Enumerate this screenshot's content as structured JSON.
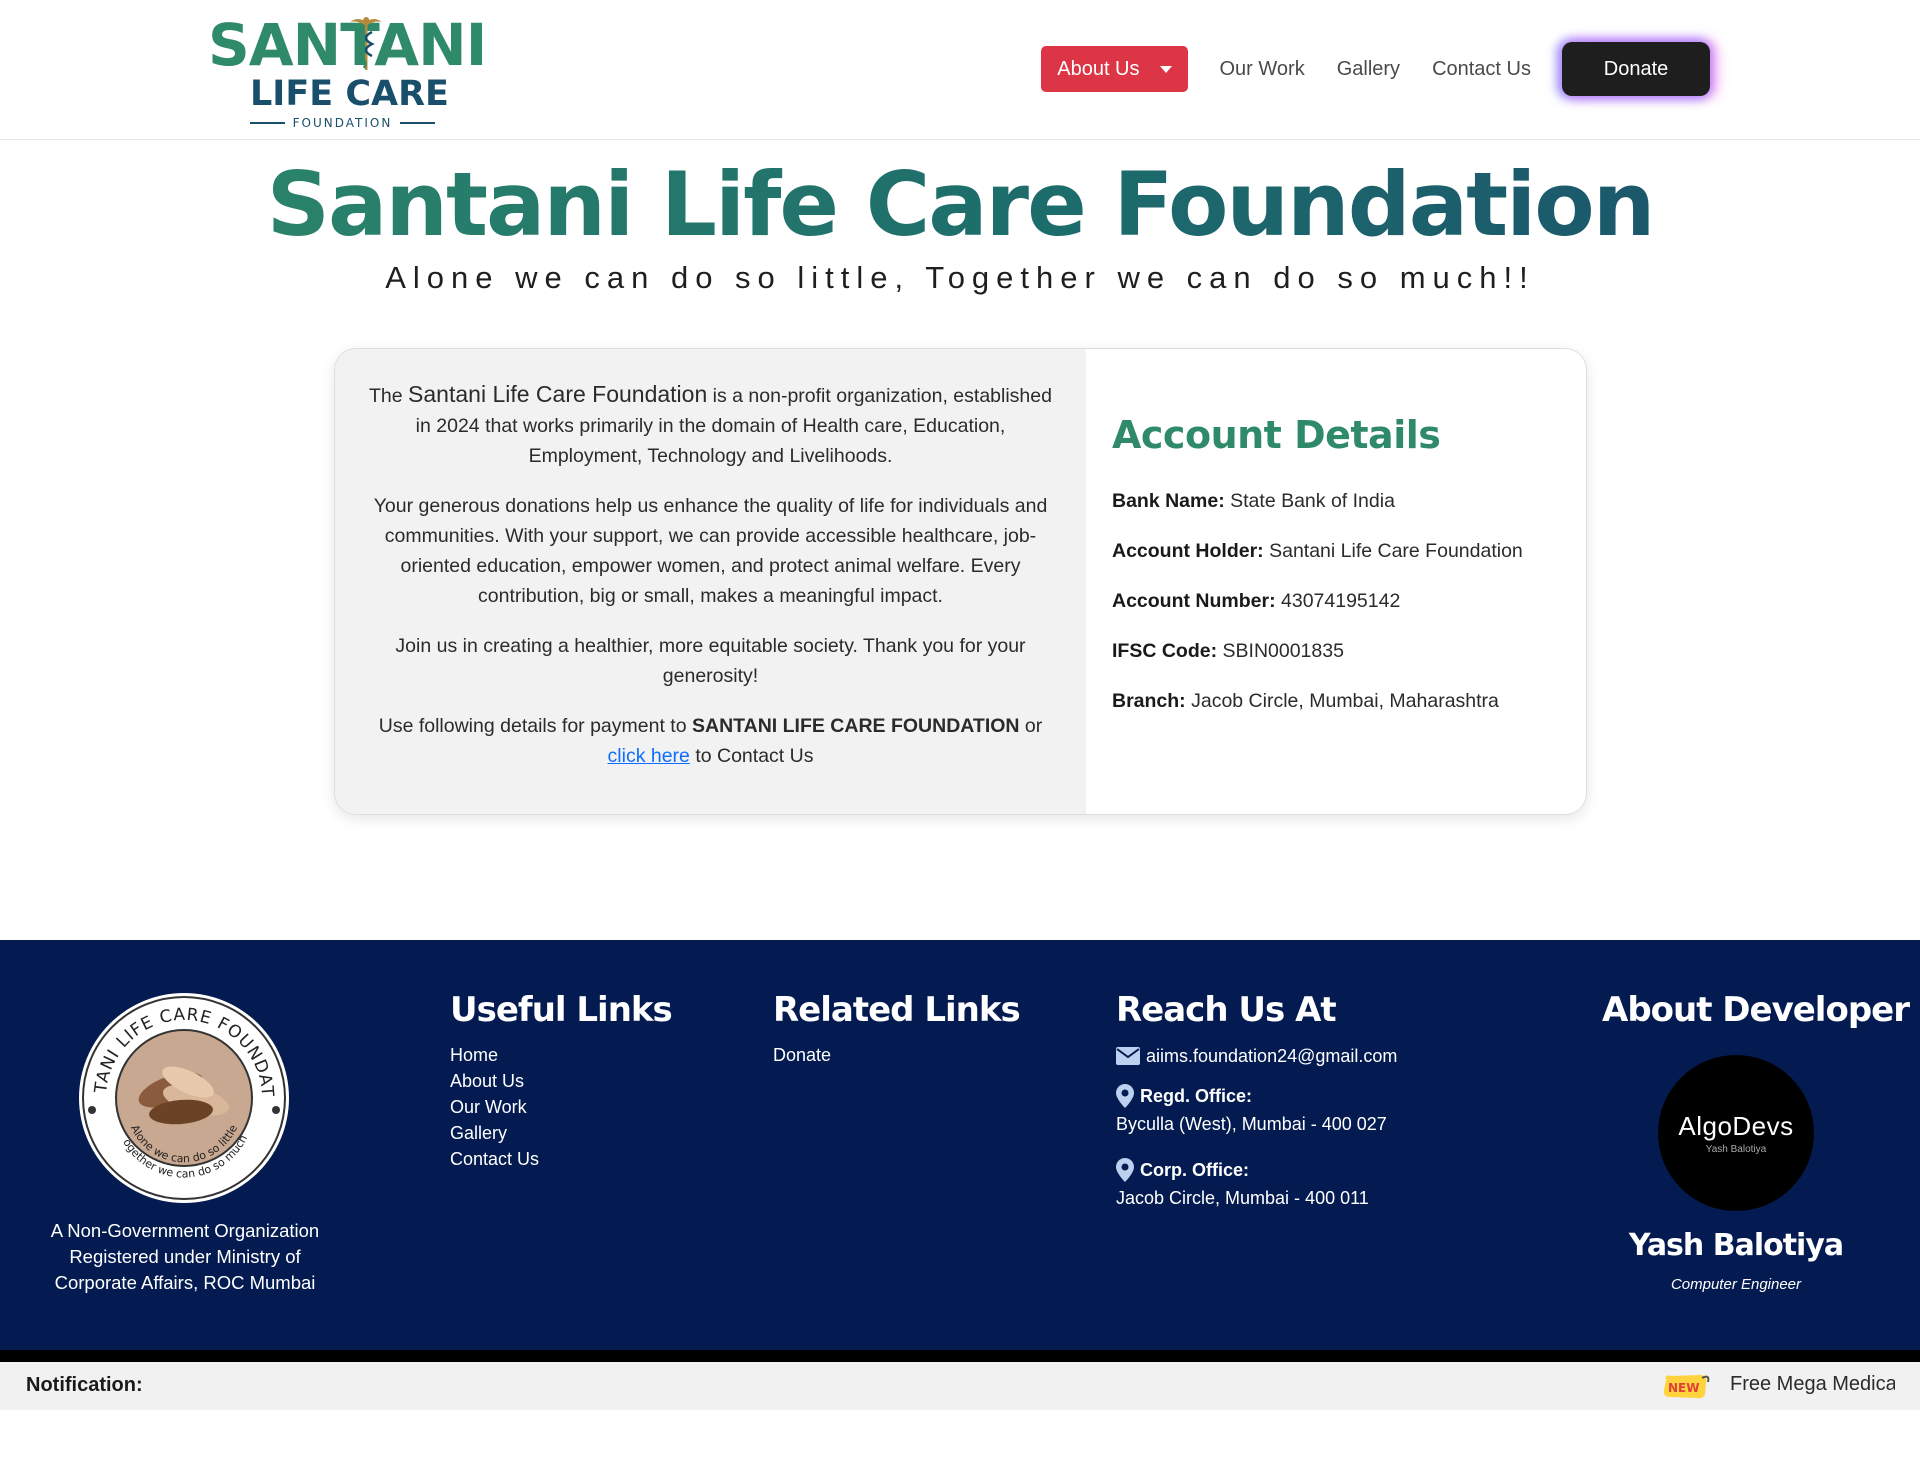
{
  "logo": {
    "line1": "SANTANI",
    "line2": "LIFE CARE",
    "line3": "FOUNDATION"
  },
  "nav": {
    "about_label": "About Us",
    "work_label": "Our Work",
    "gallery_label": "Gallery",
    "contact_label": "Contact Us",
    "donate_label": "Donate"
  },
  "hero": {
    "title": "Santani Life Care Foundation",
    "subtitle": "Alone we can do so little, Together we can do so much!!"
  },
  "intro": {
    "p1_pre": "The ",
    "p1_brand": "Santani Life Care Foundation",
    "p1_post": " is a non-profit organization, established in 2024 that works primarily in the domain of Health care, Education, Employment, Technology and Livelihoods.",
    "p2": "Your generous donations help us enhance the quality of life for individuals and communities. With your support, we can provide accessible healthcare, job-oriented education, empower women, and protect animal welfare. Every contribution, big or small, makes a meaningful impact.",
    "p3": "Join us in creating a healthier, more equitable society. Thank you for your generosity!",
    "p4_pre": "Use following details for payment to ",
    "p4_bold": "SANTANI LIFE CARE FOUNDATION",
    "p4_mid": " or ",
    "p4_link": "click here",
    "p4_post": " to Contact Us"
  },
  "account": {
    "heading": "Account Details",
    "bank_label": "Bank Name:",
    "bank_value": " State Bank of India",
    "holder_label": "Account Holder:",
    "holder_value": " Santani Life Care Foundation",
    "number_label": "Account Number:",
    "number_value": " 43074195142",
    "ifsc_label": "IFSC Code:",
    "ifsc_value": " SBIN0001835",
    "branch_label": "Branch:",
    "branch_value": " Jacob Circle, Mumbai, Maharashtra"
  },
  "footer": {
    "seal_text": "SANTANI LIFE CARE FOUNDATION",
    "seal_motto1": "Alone we can do so little",
    "seal_motto2": "Together we can do so much",
    "ngo_text": "A Non-Government Organization Registered under Ministry of Corporate Affairs, ROC Mumbai",
    "useful": {
      "heading": "Useful Links",
      "links": [
        "Home",
        "About Us",
        "Our Work",
        "Gallery",
        "Contact Us"
      ]
    },
    "related": {
      "heading": "Related Links",
      "links": [
        "Donate"
      ]
    },
    "reach": {
      "heading": "Reach Us At",
      "email": "aiims.foundation24@gmail.com",
      "regd_label": "Regd. Office:",
      "regd_address": "Byculla (West), Mumbai - 400 027",
      "corp_label": "Corp. Office:",
      "corp_address": "Jacob Circle, Mumbai - 400 011"
    },
    "developer": {
      "heading": "About Developer",
      "logo_title": "AlgoDevs",
      "logo_sub": "Yash Balotiya",
      "name": "Yash Balotiya",
      "role": "Computer Engineer"
    }
  },
  "notification": {
    "label": "Notification:",
    "badge": "NEW",
    "text": "Free Mega Medica"
  },
  "colors": {
    "brand_green": "#2f8a6a",
    "brand_teal": "#1a4f6b",
    "about_red": "#dc3545",
    "footer_navy": "#031b50",
    "link_blue": "#0d6efd"
  }
}
